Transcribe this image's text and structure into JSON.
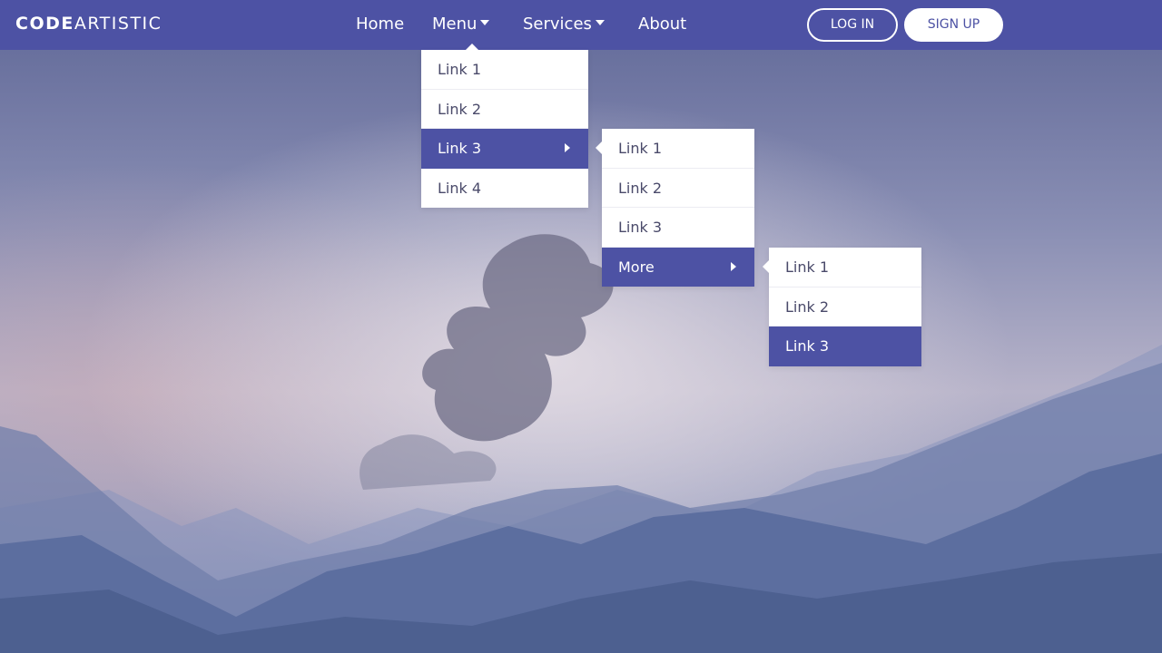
{
  "brand": {
    "bold": "CODE",
    "light": "ARTISTIC"
  },
  "nav": {
    "home": "Home",
    "menu": "Menu",
    "services": "Services",
    "about": "About"
  },
  "auth": {
    "login": "LOG IN",
    "signup": "SIGN UP"
  },
  "colors": {
    "accent": "#4d52a4",
    "white": "#ffffff",
    "text": "#4a4a6a"
  },
  "menu_dropdown": {
    "items": [
      {
        "label": "Link 1"
      },
      {
        "label": "Link 2"
      },
      {
        "label": "Link 3",
        "active": true,
        "has_submenu": true
      },
      {
        "label": "Link 4"
      }
    ]
  },
  "submenu_level2": {
    "items": [
      {
        "label": "Link 1"
      },
      {
        "label": "Link 2"
      },
      {
        "label": "Link 3"
      },
      {
        "label": "More",
        "active": true,
        "has_submenu": true
      }
    ]
  },
  "submenu_level3": {
    "items": [
      {
        "label": "Link 1"
      },
      {
        "label": "Link 2"
      },
      {
        "label": "Link 3",
        "active": true
      }
    ]
  }
}
